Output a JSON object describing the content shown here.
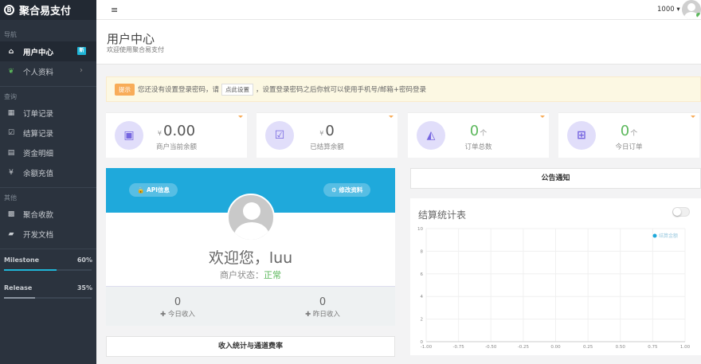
{
  "brand": {
    "name": "聚合易支付",
    "logo_glyph": "B"
  },
  "sidebar": {
    "sections": [
      {
        "label": "导航"
      },
      {
        "label": "查询"
      },
      {
        "label": "其他"
      }
    ],
    "items": [
      {
        "label": "用户中心",
        "icon": "home-icon",
        "badge": "新"
      },
      {
        "label": "个人资料",
        "icon": "leaf-icon",
        "chevron": "›"
      },
      {
        "label": "订单记录",
        "icon": "table-icon"
      },
      {
        "label": "结算记录",
        "icon": "check-square-icon"
      },
      {
        "label": "资金明细",
        "icon": "list-icon"
      },
      {
        "label": "余额充值",
        "icon": "yen-icon"
      },
      {
        "label": "聚合收款",
        "icon": "qrcode-icon"
      },
      {
        "label": "开发文档",
        "icon": "book-icon"
      }
    ],
    "progress": [
      {
        "label": "Milestone",
        "percent": "60%",
        "value": 60
      },
      {
        "label": "Release",
        "percent": "35%",
        "value": 35
      }
    ]
  },
  "topbar": {
    "menu_glyph": "≡",
    "user_label": "1000 ▾"
  },
  "page": {
    "title": "用户中心",
    "subtitle": "欢迎使用聚合易支付"
  },
  "alert": {
    "tag": "提示",
    "before": "您还没有设置登录密码，请",
    "link": "点此设置",
    "after": "，设置登录密码之后你就可以使用手机号/邮箱+密码登录"
  },
  "stats": [
    {
      "currency": "¥",
      "value": "0.00",
      "caption": "商户当前余额",
      "icon": "money-icon",
      "glyph": "▣"
    },
    {
      "currency": "¥",
      "value": "0",
      "caption": "已结算余额",
      "icon": "check-square-icon",
      "glyph": "☑"
    },
    {
      "value": "0",
      "unit": "个",
      "caption": "订单总数",
      "icon": "area-chart-icon",
      "glyph": "◭"
    },
    {
      "value": "0",
      "unit": "个",
      "caption": "今日订单",
      "icon": "cart-icon",
      "glyph": "⊞"
    }
  ],
  "profile": {
    "api_button": "🔒 API信息",
    "edit_button": "⚙ 修改资料",
    "welcome": "欢迎您，luu",
    "status_label": "商户状态：",
    "status_value": "正常"
  },
  "income": [
    {
      "value": "0",
      "label": "✚ 今日收入"
    },
    {
      "value": "0",
      "label": "✚ 昨日收入"
    }
  ],
  "buttons": {
    "announcement": "公告通知",
    "rates": "收入统计与通道费率"
  },
  "chart_data": {
    "type": "line",
    "title": "结算统计表",
    "series": [
      {
        "name": "结算金额",
        "values": []
      }
    ],
    "x_ticks": [
      "-1.00",
      "-0.75",
      "-0.50",
      "-0.25",
      "0.00",
      "0.25",
      "0.50",
      "0.75",
      "1.00"
    ],
    "y_ticks": [
      "0",
      "2",
      "4",
      "6",
      "8",
      "10"
    ],
    "xlim": [
      -1,
      1
    ],
    "ylim": [
      0,
      10
    ],
    "legend_position": "top-right",
    "grid": true,
    "color": "#1fa9db"
  }
}
